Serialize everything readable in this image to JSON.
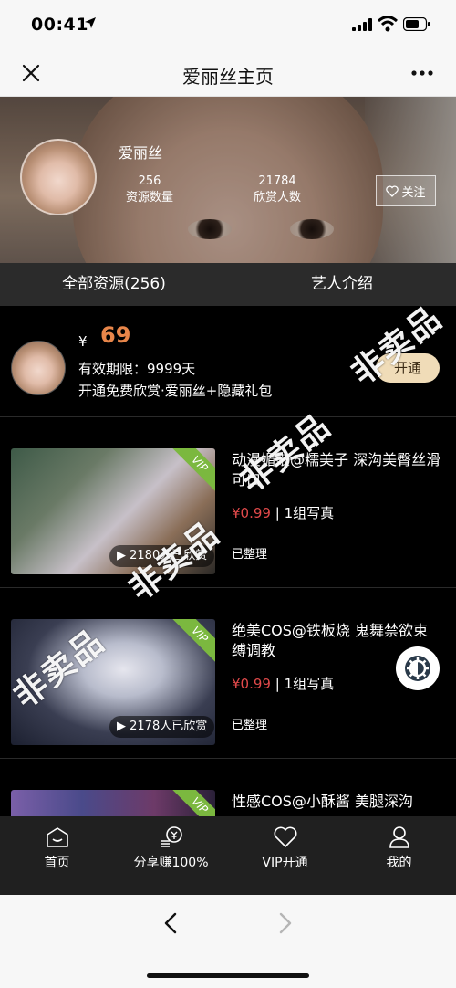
{
  "status_bar": {
    "time": "00:41"
  },
  "nav": {
    "title": "爱丽丝主页"
  },
  "profile": {
    "name": "爱丽丝",
    "resources_count": "256",
    "resources_label": "资源数量",
    "viewers_count": "21784",
    "viewers_label": "欣赏人数",
    "follow_label": "关注"
  },
  "tabs": [
    {
      "label": "全部资源(256)"
    },
    {
      "label": "艺人介绍"
    }
  ],
  "vip_offer": {
    "currency": "¥",
    "price": "69",
    "validity": "有效期限：9999天",
    "benefit": "开通免费欣赏·爱丽丝+隐藏礼包",
    "button_label": "开通"
  },
  "items": [
    {
      "title": "动漫媚娘@糯美子 深沟美臀丝滑可口",
      "price": "¥0.99",
      "set": "1组写真",
      "views": "2180人已欣赏",
      "status": "已整理",
      "vip": "VIP"
    },
    {
      "title": "绝美COS@铁板烧 鬼舞禁欲束缚调教",
      "price": "¥0.99",
      "set": "1组写真",
      "views": "2178人已欣赏",
      "status": "已整理",
      "vip": "VIP"
    },
    {
      "title": "性感COS@小酥酱 美腿深沟",
      "price": "",
      "set": "",
      "views": "",
      "status": "",
      "vip": "VIP"
    }
  ],
  "watermark": "非卖品",
  "tabbar": [
    {
      "label": "首页",
      "icon": "home-icon"
    },
    {
      "label": "分享赚100%",
      "icon": "share-money-icon"
    },
    {
      "label": "VIP开通",
      "icon": "heart-icon"
    },
    {
      "label": "我的",
      "icon": "user-icon"
    }
  ],
  "colors": {
    "price_accent": "#e8864a",
    "item_price": "#e0494a",
    "vip_tag": "#7bb83f",
    "open_button": "#f0dcb8"
  }
}
